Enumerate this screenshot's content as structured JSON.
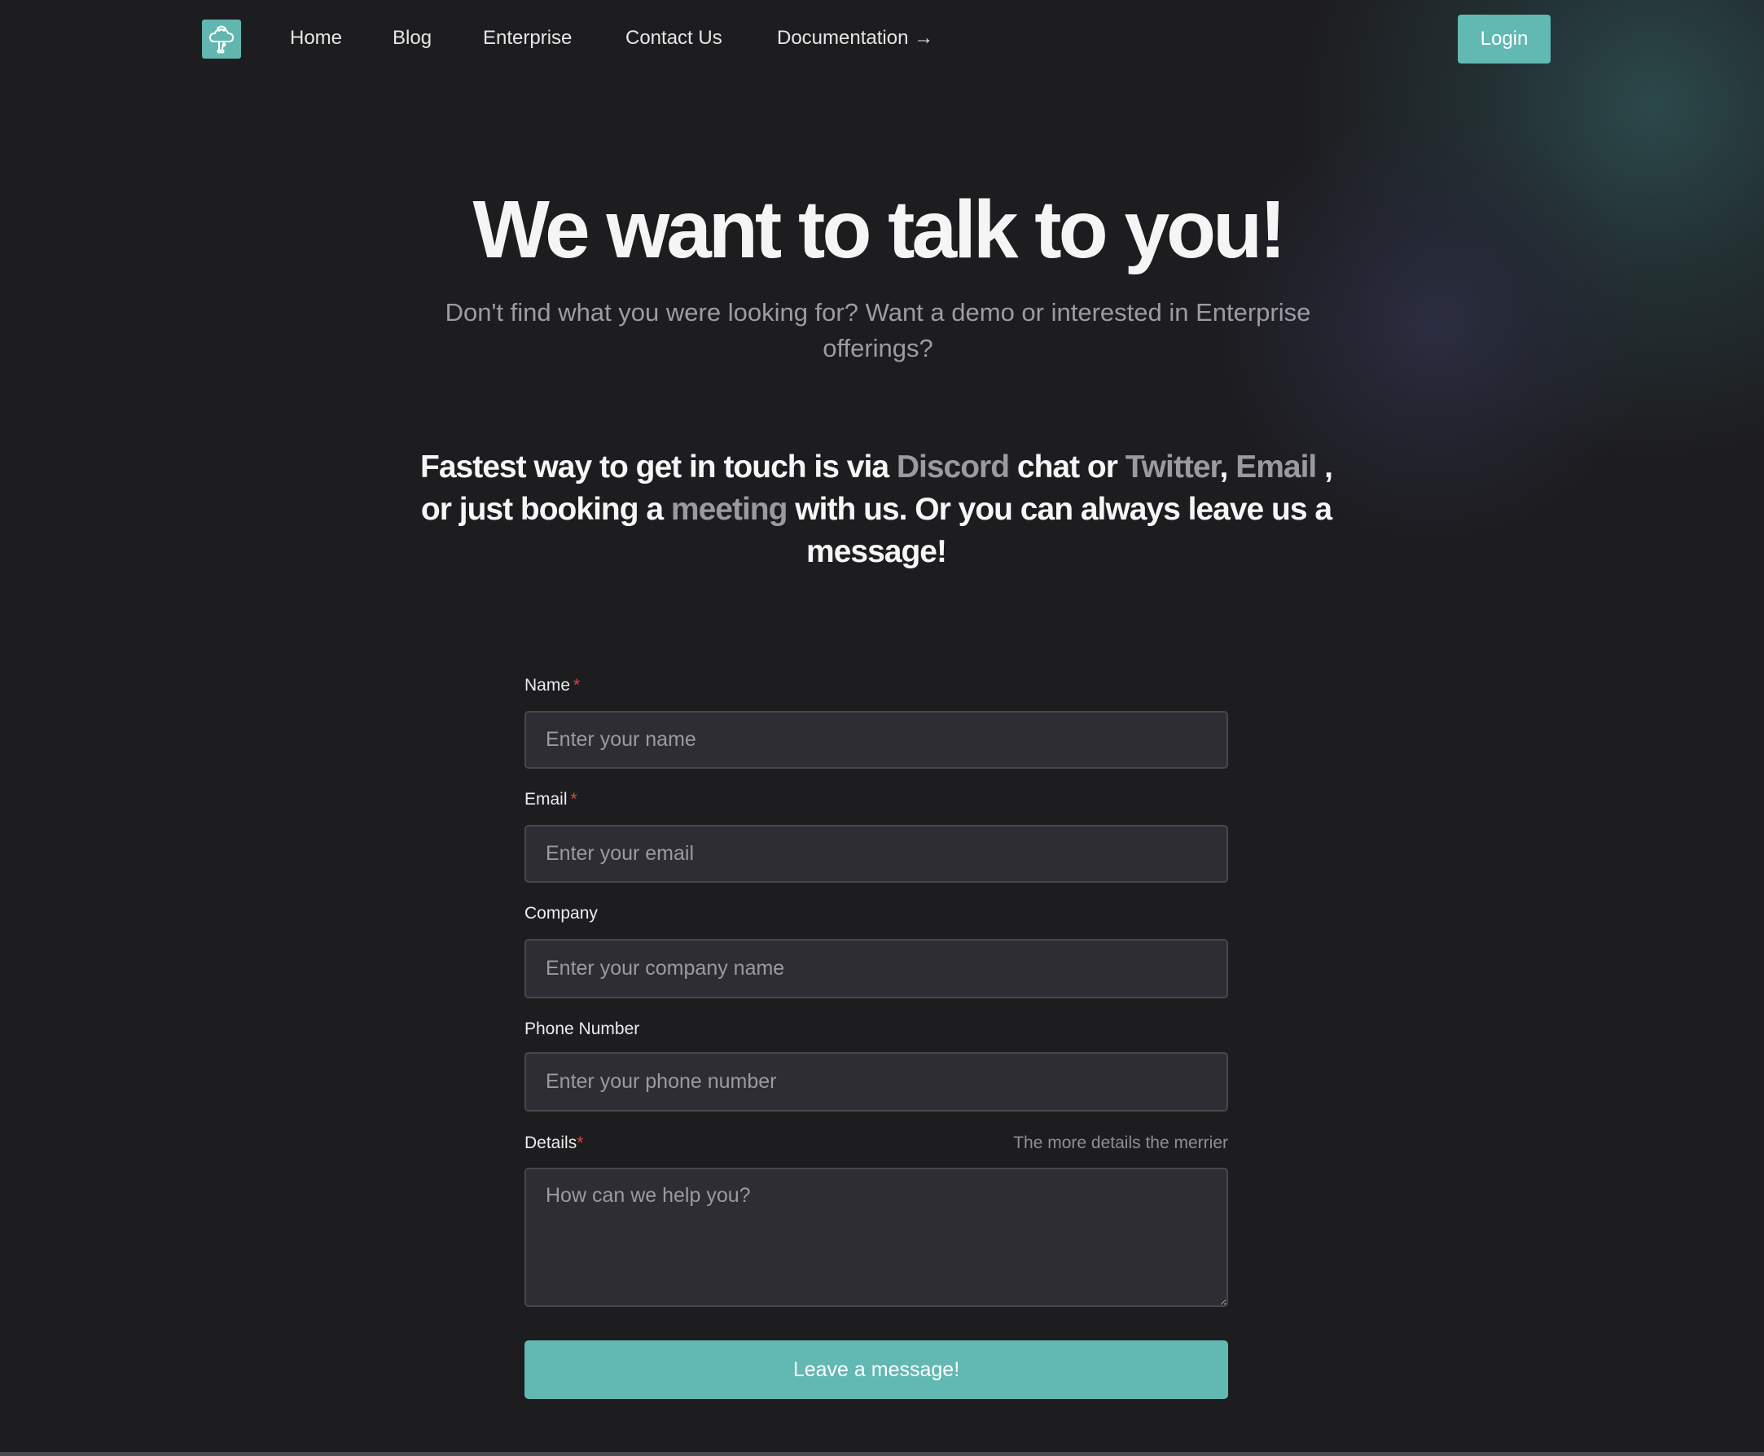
{
  "nav": {
    "logo_icon": "cloud-wifi-icon",
    "links": [
      {
        "label": "Home"
      },
      {
        "label": "Blog"
      },
      {
        "label": "Enterprise"
      },
      {
        "label": "Contact Us"
      },
      {
        "label": "Documentation →"
      }
    ],
    "login_label": "Login"
  },
  "hero": {
    "title": "We want to talk to you!",
    "subtitle": "Don't find what you were looking for? Want a demo or interested in Enterprise offerings?"
  },
  "contact": {
    "t1": "Fastest way to get in touch is via ",
    "discord": "Discord",
    "t2": " chat or ",
    "twitter": "Twitter",
    "t3": ", ",
    "email": "Email",
    "t4": " , or just booking a ",
    "meeting": "meeting",
    "t5": " with us. Or you can always leave us a message!"
  },
  "form": {
    "name": {
      "label": "Name",
      "required": "*",
      "placeholder": "Enter your name",
      "value": ""
    },
    "email": {
      "label": "Email",
      "required": "*",
      "placeholder": "Enter your email",
      "value": ""
    },
    "company": {
      "label": "Company",
      "placeholder": "Enter your company name",
      "value": ""
    },
    "phone": {
      "label": "Phone Number",
      "placeholder": "Enter your phone number",
      "value": ""
    },
    "details": {
      "label": "Details",
      "required": "*",
      "hint": "The more details the merrier",
      "placeholder": "How can we help you?",
      "value": ""
    },
    "submit_label": "Leave a message!"
  },
  "colors": {
    "accent": "#62b8b2",
    "background": "#1d1d20",
    "input_bg": "#2e2d33",
    "required": "#e0443e",
    "link_muted": "#9a9aa0"
  }
}
